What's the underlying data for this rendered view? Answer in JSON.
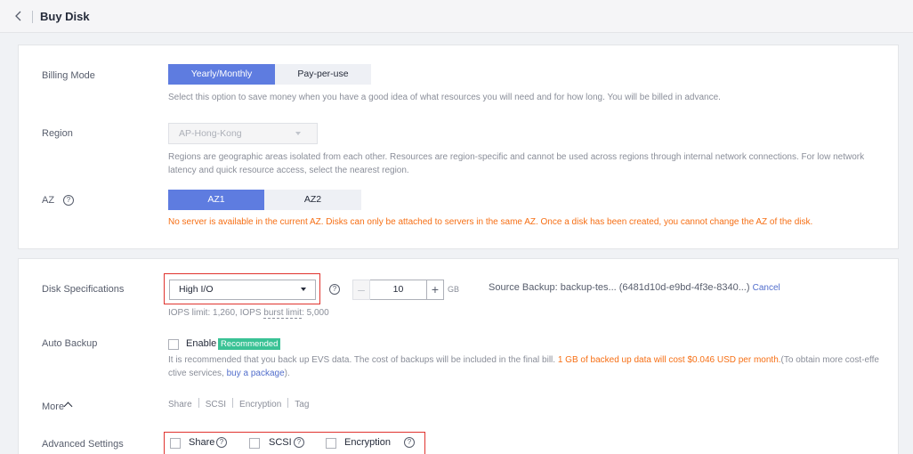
{
  "header": {
    "title": "Buy Disk"
  },
  "billing": {
    "label": "Billing Mode",
    "options": [
      "Yearly/Monthly",
      "Pay-per-use"
    ],
    "hint": "Select this option to save money when you have a good idea of what resources you will need and for how long. You will be billed in advance."
  },
  "region": {
    "label": "Region",
    "value": "AP-Hong-Kong",
    "hint_line1": "Regions are geographic areas isolated from each other. Resources are region-specific and cannot be used across regions through internal network connections. For low network",
    "hint_line2": "latency and quick resource access, select the nearest region."
  },
  "az": {
    "label": "AZ",
    "options": [
      "AZ1",
      "AZ2"
    ],
    "warning": "No server is available in the current AZ. Disks can only be attached to servers in the same AZ. Once a disk has been created, you cannot change the AZ of the disk."
  },
  "disk": {
    "label": "Disk Specifications",
    "type": "High I/O",
    "size": "10",
    "unit": "GB",
    "iops_prefix": "IOPS limit: 1,260, IOPS ",
    "iops_burst": "burst limit",
    "iops_suffix": ": 5,000",
    "source_backup": "Source Backup: backup-tes... (6481d10d-e9bd-4f3e-8340...)",
    "cancel": "Cancel"
  },
  "backup": {
    "label": "Auto Backup",
    "enable": "Enable",
    "badge": "Recommended",
    "hint_part1": "It is recommended that you back up EVS data. The cost of backups will be included in the final bill. ",
    "hint_price": "1 GB of backed up data will cost $0.046 USD per month.",
    "hint_part2": "(To obtain more cost-effe",
    "hint_line2_prefix": "ctive services, ",
    "hint_link": "buy a package",
    "hint_line2_suffix": ")."
  },
  "more": {
    "label": "More",
    "tags": [
      "Share",
      "SCSI",
      "Encryption",
      "Tag"
    ]
  },
  "advanced": {
    "label": "Advanced Settings",
    "options": [
      "Share",
      "SCSI",
      "Encryption"
    ]
  },
  "colors": {
    "primary": "#5e7ce0",
    "warning": "#f66f15",
    "highlight": "#e0332e",
    "recommend": "#3ac295"
  }
}
